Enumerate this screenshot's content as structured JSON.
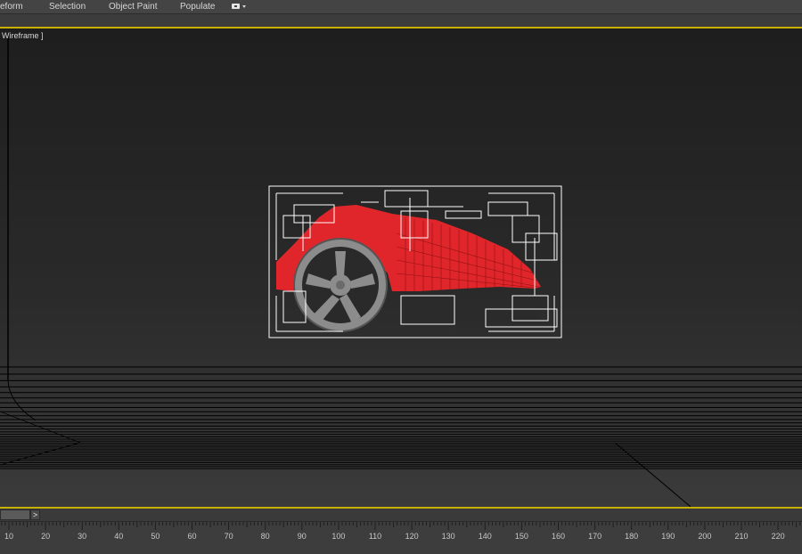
{
  "ribbon": {
    "tabs": [
      {
        "label": "eform"
      },
      {
        "label": "Selection"
      },
      {
        "label": "Object Paint"
      },
      {
        "label": "Populate"
      }
    ],
    "options_icon": "viewport-camera-icon"
  },
  "viewport": {
    "label": "Wireframe ]",
    "active_border_color": "#c8b000",
    "model_color": "#e0262a",
    "wheel_color": "#8c8c8c",
    "wireframe_color": "#ffffff"
  },
  "time_slider": {
    "next_label": ">"
  },
  "track_bar": {
    "ticks": [
      {
        "label": "10"
      },
      {
        "label": "20"
      },
      {
        "label": "30"
      },
      {
        "label": "40"
      },
      {
        "label": "50"
      },
      {
        "label": "60"
      },
      {
        "label": "70"
      },
      {
        "label": "80"
      },
      {
        "label": "90"
      },
      {
        "label": "100"
      },
      {
        "label": "110"
      },
      {
        "label": "120"
      },
      {
        "label": "130"
      },
      {
        "label": "140"
      },
      {
        "label": "150"
      },
      {
        "label": "160"
      },
      {
        "label": "170"
      },
      {
        "label": "180"
      },
      {
        "label": "190"
      },
      {
        "label": "200"
      },
      {
        "label": "210"
      },
      {
        "label": "220"
      }
    ]
  }
}
